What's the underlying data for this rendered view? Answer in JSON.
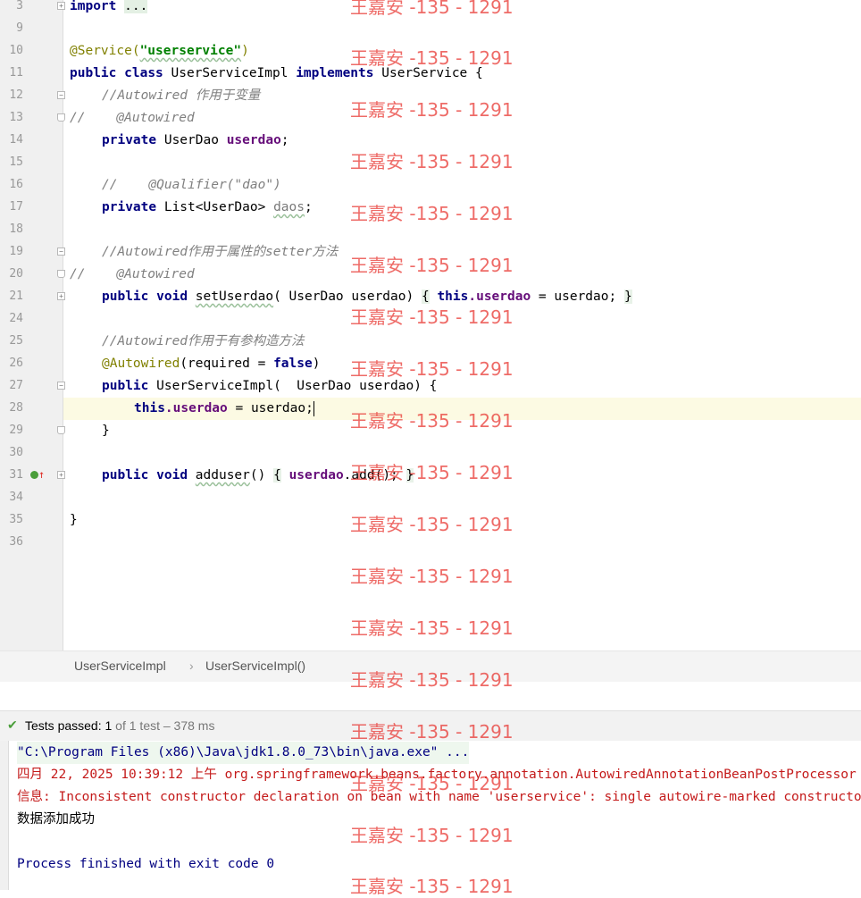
{
  "editor": {
    "gutter": [
      {
        "n": "3"
      },
      {
        "n": "9"
      },
      {
        "n": "10"
      },
      {
        "n": "11"
      },
      {
        "n": "12"
      },
      {
        "n": "13"
      },
      {
        "n": "14"
      },
      {
        "n": "15"
      },
      {
        "n": "16"
      },
      {
        "n": "17"
      },
      {
        "n": "18"
      },
      {
        "n": "19"
      },
      {
        "n": "20"
      },
      {
        "n": "21"
      },
      {
        "n": "24"
      },
      {
        "n": "25"
      },
      {
        "n": "26"
      },
      {
        "n": "27"
      },
      {
        "n": "28"
      },
      {
        "n": "29"
      },
      {
        "n": "30"
      },
      {
        "n": "31"
      },
      {
        "n": "34"
      },
      {
        "n": "35"
      },
      {
        "n": "36"
      }
    ],
    "code": {
      "l3_kw": "import",
      "l3_rest": "...",
      "l10_ann": "@Service(",
      "l10_str": "\"userservice\"",
      "l10_close": ")",
      "l11_kw1": "public",
      "l11_kw2": "class",
      "l11_name": "UserServiceImpl",
      "l11_kw3": "implements",
      "l11_iface": "UserService {",
      "l12": "//Autowired 作用于变量",
      "l13": "//    @Autowired",
      "l14_kw": "private",
      "l14_type": "UserDao",
      "l14_fld": "userdao",
      "l14_end": ";",
      "l16": "//    @Qualifier(\"dao\")",
      "l17_kw": "private",
      "l17_type": "List<UserDao>",
      "l17_fld": "daos",
      "l17_end": ";",
      "l19": "//Autowired作用于属性的setter方法",
      "l20": "//    @Autowired",
      "l21_kw1": "public",
      "l21_kw2": "void",
      "l21_name": "setUserdao",
      "l21_params": "( UserDao userdao)",
      "l21_open": "{",
      "l21_this": "this",
      "l21_fld": ".userdao",
      "l21_rest": " = userdao; ",
      "l21_close": "}",
      "l25": "//Autowired作用于有参构造方法",
      "l26_ann": "@Autowired",
      "l26_rest1": "(required = ",
      "l26_kw": "false",
      "l26_rest2": ")",
      "l27_kw": "public",
      "l27_rest": "UserServiceImpl(  UserDao userdao) {",
      "l28_this": "this",
      "l28_fld": ".userdao",
      "l28_rest": " = userdao;",
      "l29": "}",
      "l31_kw1": "public",
      "l31_kw2": "void",
      "l31_name": "adduser",
      "l31_paren": "() ",
      "l31_open": "{",
      "l31_fld": "userdao",
      "l31_rest": ".add(); ",
      "l31_close": "}",
      "l35": "}"
    }
  },
  "breadcrumb": {
    "class_name": "UserServiceImpl",
    "separator": "›",
    "member": "UserServiceImpl()"
  },
  "tests": {
    "label": "Tests passed: ",
    "count": "1",
    "detail": " of 1 test – 378 ms"
  },
  "console": {
    "line1": "\"C:\\Program Files (x86)\\Java\\jdk1.8.0_73\\bin\\java.exe\" ...",
    "line2": "四月 22, 2025 10:39:12 上午 org.springframework.beans.factory.annotation.AutowiredAnnotationBeanPostProcessor",
    "line3": "信息: Inconsistent constructor declaration on bean with name 'userservice': single autowire-marked constructor",
    "line4": "数据添加成功",
    "line5": "Process finished with exit code 0"
  },
  "watermark": "王嘉安 -135 - 1291",
  "colors": {
    "keyword": "#000080",
    "annotation": "#808000",
    "string": "#008000",
    "comment": "#808080",
    "field": "#660e7a",
    "watermark": "#e8332e",
    "error_text": "#c41a1a",
    "pass_icon": "#4a9e3a"
  }
}
